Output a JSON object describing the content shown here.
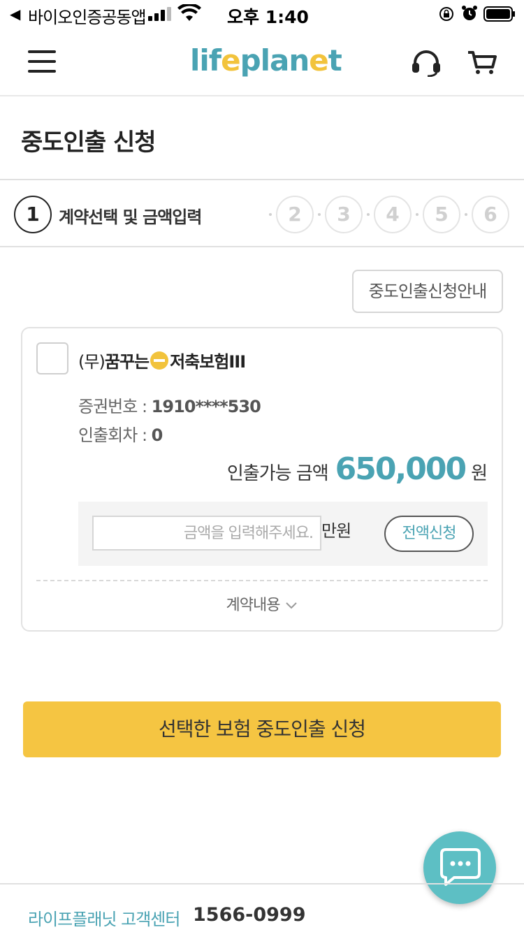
{
  "status_bar": {
    "back_glyph": "◀",
    "app_name": "바이오인증공동앱",
    "time": "오후 1:40"
  },
  "header": {
    "logo_left": "lif",
    "logo_e": "e",
    "logo_mid": "plan",
    "logo_e2": "e",
    "logo_right": "t",
    "icons": [
      "menu-icon",
      "headset-icon",
      "cart-icon"
    ]
  },
  "page": {
    "title": "중도인출 신청"
  },
  "steps": {
    "active_number": "1",
    "active_label": "계약선택 및 금액입력",
    "others": [
      "2",
      "3",
      "4",
      "5",
      "6"
    ]
  },
  "guide_button": "중도인출신청안내",
  "contract": {
    "name_prefix": "(무)",
    "name_part1": "꿈꾸는",
    "name_part2": "저축보험III",
    "policy_label": "증권번호 : ",
    "policy_number": "1910****530",
    "withdraw_count_label": "인출회차 : ",
    "withdraw_count": "0",
    "available_label": "인출가능 금액",
    "available_amount": "650,000",
    "available_unit": "원",
    "input_placeholder": "금액을 입력해주세요.",
    "input_unit": "만원",
    "all_button": "전액신청",
    "details_toggle": "계약내용"
  },
  "submit_button": "선택한 보험 중도인출 신청",
  "footer": {
    "label": "라이프플래닛 고객센터",
    "phone": "1566-0999"
  },
  "colors": {
    "brand_teal": "#4aa3b3",
    "brand_yellow": "#f5c542",
    "chat_bubble": "#5dbfc4"
  }
}
